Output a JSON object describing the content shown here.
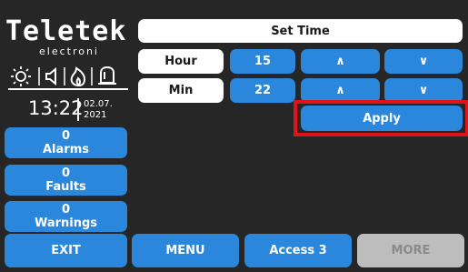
{
  "brand": {
    "name": "Teletek",
    "sub": "electroni"
  },
  "status_icons": [
    "brightness-icon",
    "volume-icon",
    "fire-icon",
    "bell-icon"
  ],
  "clock": {
    "time": "13:22",
    "date_line1": "02.07.",
    "date_line2": "2021"
  },
  "sidebar": {
    "alarms": {
      "count": "0",
      "label": "Alarms"
    },
    "faults": {
      "count": "0",
      "label": "Faults"
    },
    "warnings": {
      "count": "0",
      "label": "Warnings"
    }
  },
  "set_time": {
    "title": "Set Time",
    "hour_label": "Hour",
    "hour_value": "15",
    "min_label": "Min",
    "min_value": "22",
    "up_glyph": "∧",
    "down_glyph": "∨",
    "apply_label": "Apply"
  },
  "footer": {
    "exit": "EXIT",
    "menu": "MENU",
    "access": "Access 3",
    "more": "MORE"
  },
  "colors": {
    "background": "#262626",
    "button_blue": "#2a87dc",
    "highlight_red": "#e0121b",
    "disabled_gray": "#bdbdbd"
  }
}
